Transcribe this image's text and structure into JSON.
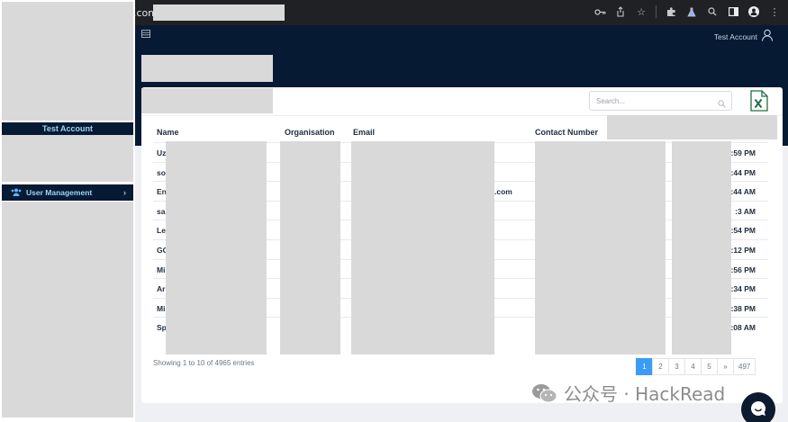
{
  "browser": {
    "url_prefix": ".com/",
    "icons": [
      "key-icon",
      "share-icon",
      "star-icon",
      "extensions-icon",
      "labs-icon",
      "search-icon",
      "sidebar-icon",
      "profile-icon",
      "more-icon"
    ]
  },
  "sidebar": {
    "account_name": "Test Account",
    "menu_item": "User Management",
    "menu_item_icon": "users-icon",
    "chevron": "›"
  },
  "header": {
    "account_label": "Test Account"
  },
  "search": {
    "placeholder": "Search..."
  },
  "table": {
    "headers": {
      "name": "Name",
      "organisation": "Organisation",
      "email": "Email",
      "contact": "Contact Number"
    },
    "rows": [
      {
        "name": "Uz",
        "email": "",
        "time": ":59 PM"
      },
      {
        "name": "so",
        "email": "",
        "time": ":44 PM"
      },
      {
        "name": "En",
        "email": ".com",
        "time": ":44 AM"
      },
      {
        "name": "sa",
        "email": "",
        "time": ":3 AM"
      },
      {
        "name": "Le",
        "email": "",
        "time": ":54 PM"
      },
      {
        "name": "GC",
        "email": "",
        "time": ":12 PM"
      },
      {
        "name": "Mi",
        "email": "",
        "time": ":56 PM"
      },
      {
        "name": "Ar",
        "email": "",
        "time": ":34 PM"
      },
      {
        "name": "Mi",
        "email": "",
        "time": ":38 PM"
      },
      {
        "name": "Sp",
        "email": "",
        "time": ":08 AM"
      }
    ]
  },
  "footer": {
    "showing": "Showing 1 to 10 of 4965 entries"
  },
  "pagination": {
    "pages": [
      "1",
      "2",
      "3",
      "4",
      "5",
      "»",
      "497"
    ],
    "active": "1"
  },
  "watermark": {
    "text": "公众号 · HackRead"
  },
  "colors": {
    "navy": "#071a33",
    "accent": "#3b9cf3",
    "excel_green": "#1d6f42"
  }
}
